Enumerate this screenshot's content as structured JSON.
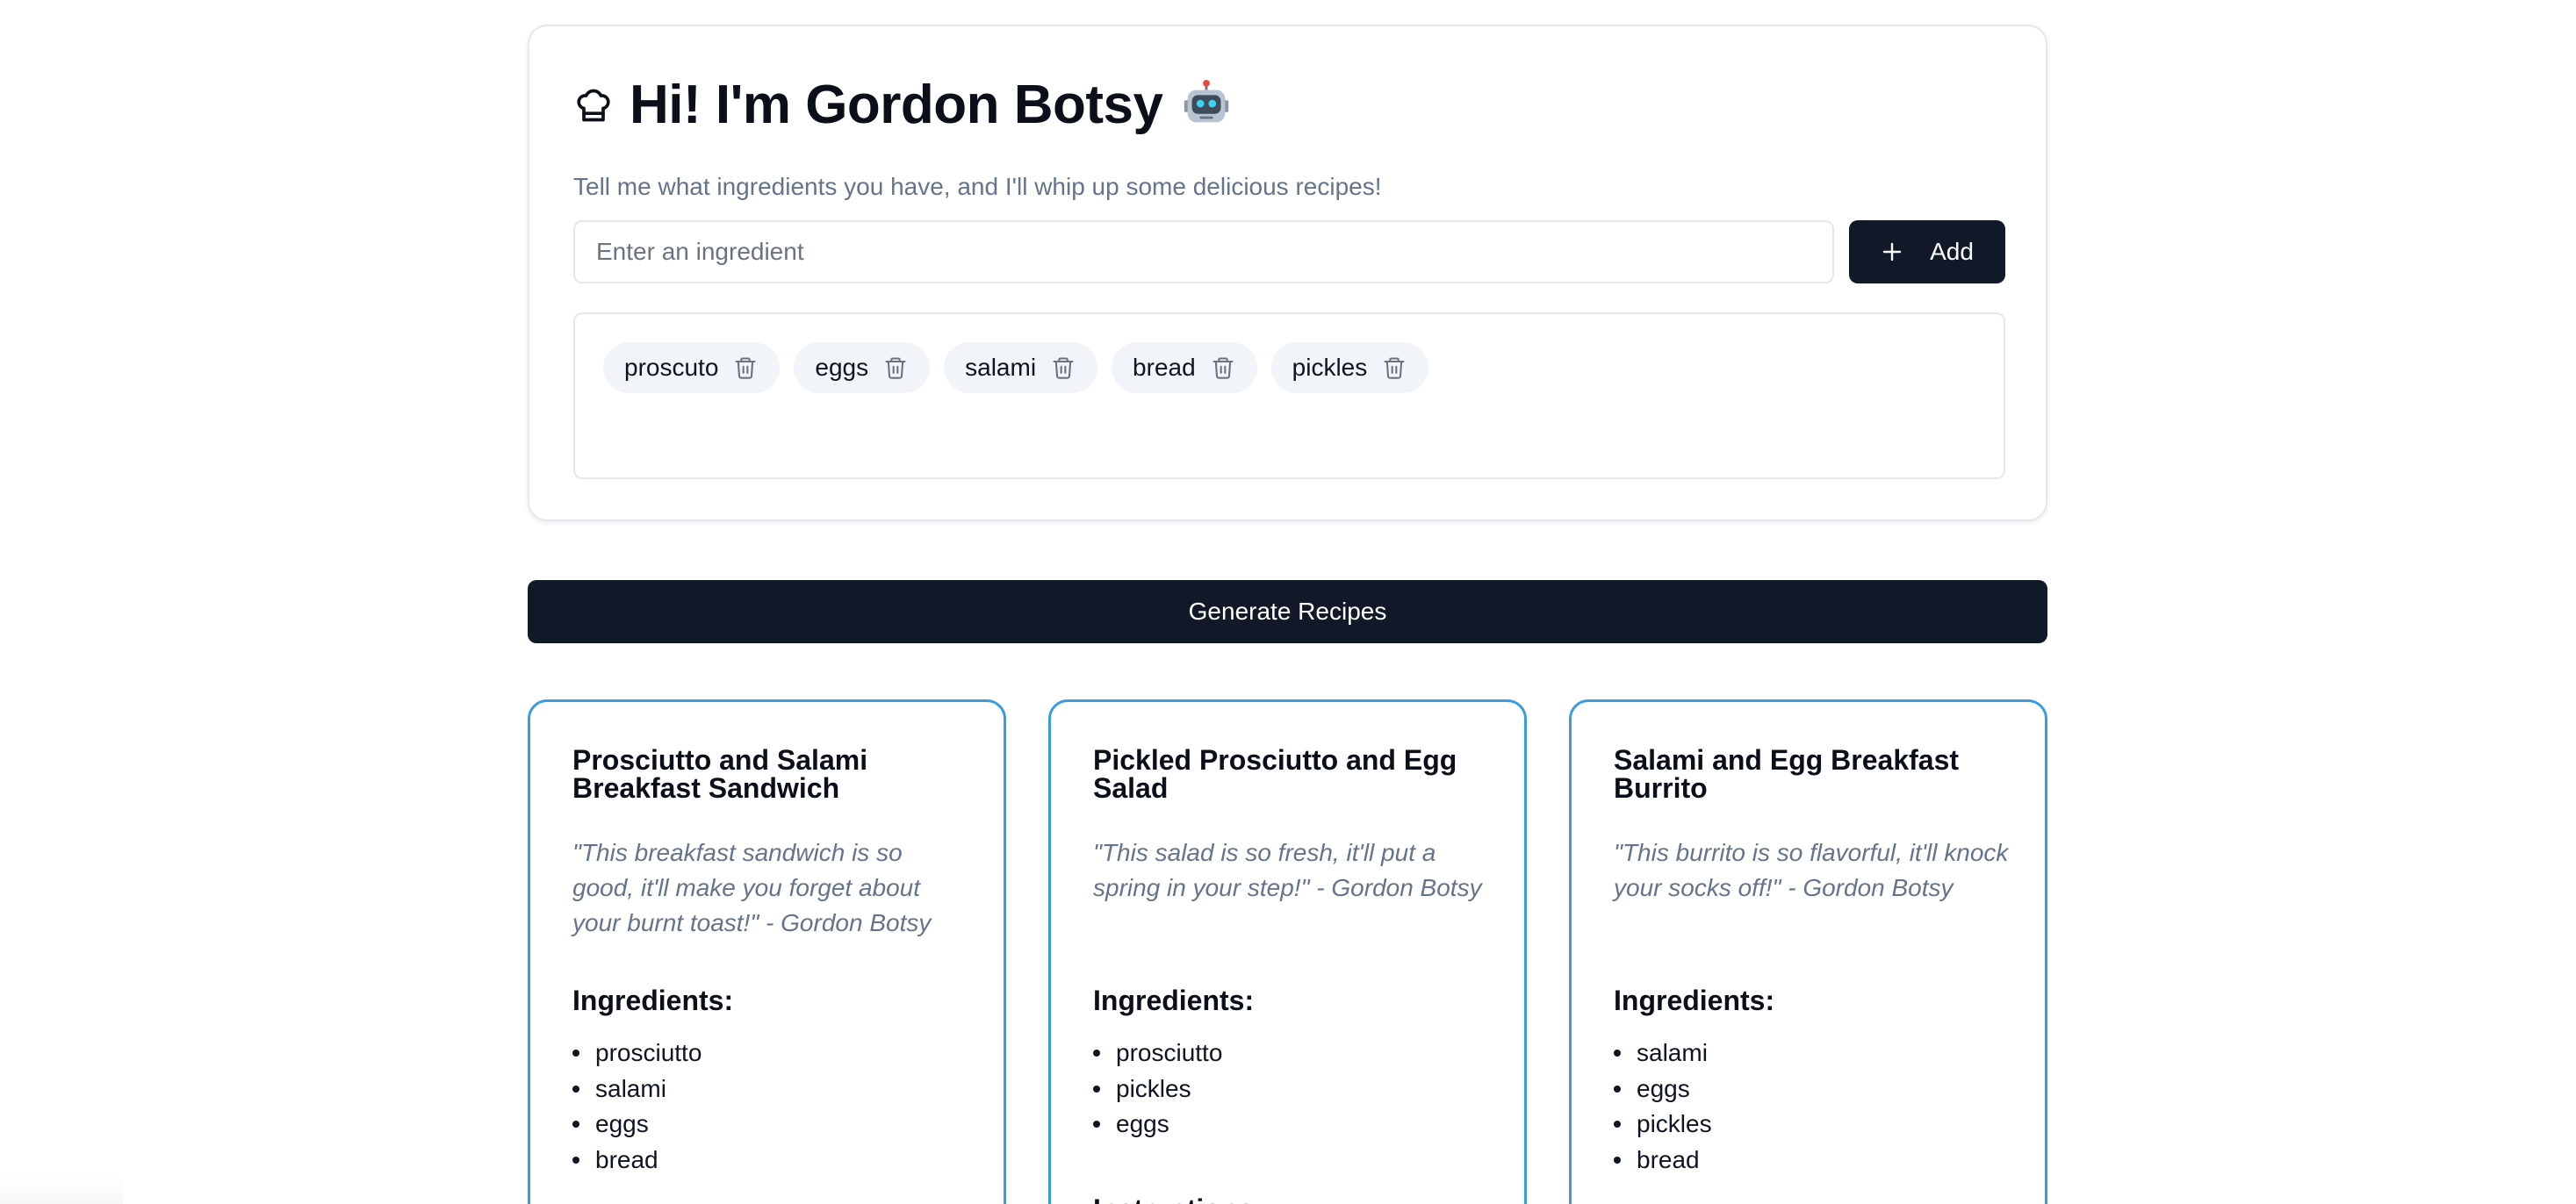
{
  "header": {
    "title": "Hi! I'm Gordon Botsy",
    "subtitle": "Tell me what ingredients you have, and I'll whip up some delicious recipes!",
    "chef_icon": "chef-hat-icon",
    "robot_icon": "robot-icon"
  },
  "ingredient_form": {
    "input_placeholder": "Enter an ingredient",
    "input_value": "",
    "add_label": "Add",
    "add_icon": "plus-icon"
  },
  "chips": [
    {
      "label": "proscuto",
      "icon": "trash-icon"
    },
    {
      "label": "eggs",
      "icon": "trash-icon"
    },
    {
      "label": "salami",
      "icon": "trash-icon"
    },
    {
      "label": "bread",
      "icon": "trash-icon"
    },
    {
      "label": "pickles",
      "icon": "trash-icon"
    }
  ],
  "generate_label": "Generate Recipes",
  "recipes": [
    {
      "title": "Prosciutto and Salami Breakfast Sandwich",
      "quote": "\"This breakfast sandwich is so good, it'll make you forget about your burnt toast!\" - Gordon Botsy",
      "ingredients_heading": "Ingredients:",
      "ingredients": [
        "prosciutto",
        "salami",
        "eggs",
        "bread"
      ],
      "instructions_heading": ""
    },
    {
      "title": "Pickled Prosciutto and Egg Salad",
      "quote": "\"This salad is so fresh, it'll put a spring in your step!\" - Gordon Botsy",
      "ingredients_heading": "Ingredients:",
      "ingredients": [
        "prosciutto",
        "pickles",
        "eggs"
      ],
      "instructions_heading": "Instructions:"
    },
    {
      "title": "Salami and Egg Breakfast Burrito",
      "quote": "\"This burrito is so flavorful, it'll knock your socks off!\" - Gordon Botsy",
      "ingredients_heading": "Ingredients:",
      "ingredients": [
        "salami",
        "eggs",
        "pickles",
        "bread"
      ],
      "instructions_heading": ""
    }
  ],
  "colors": {
    "primary_dark": "#111827",
    "card_border_accent": "#3b9be0",
    "muted_text": "#64748b",
    "chip_bg": "#f1f5f9"
  }
}
